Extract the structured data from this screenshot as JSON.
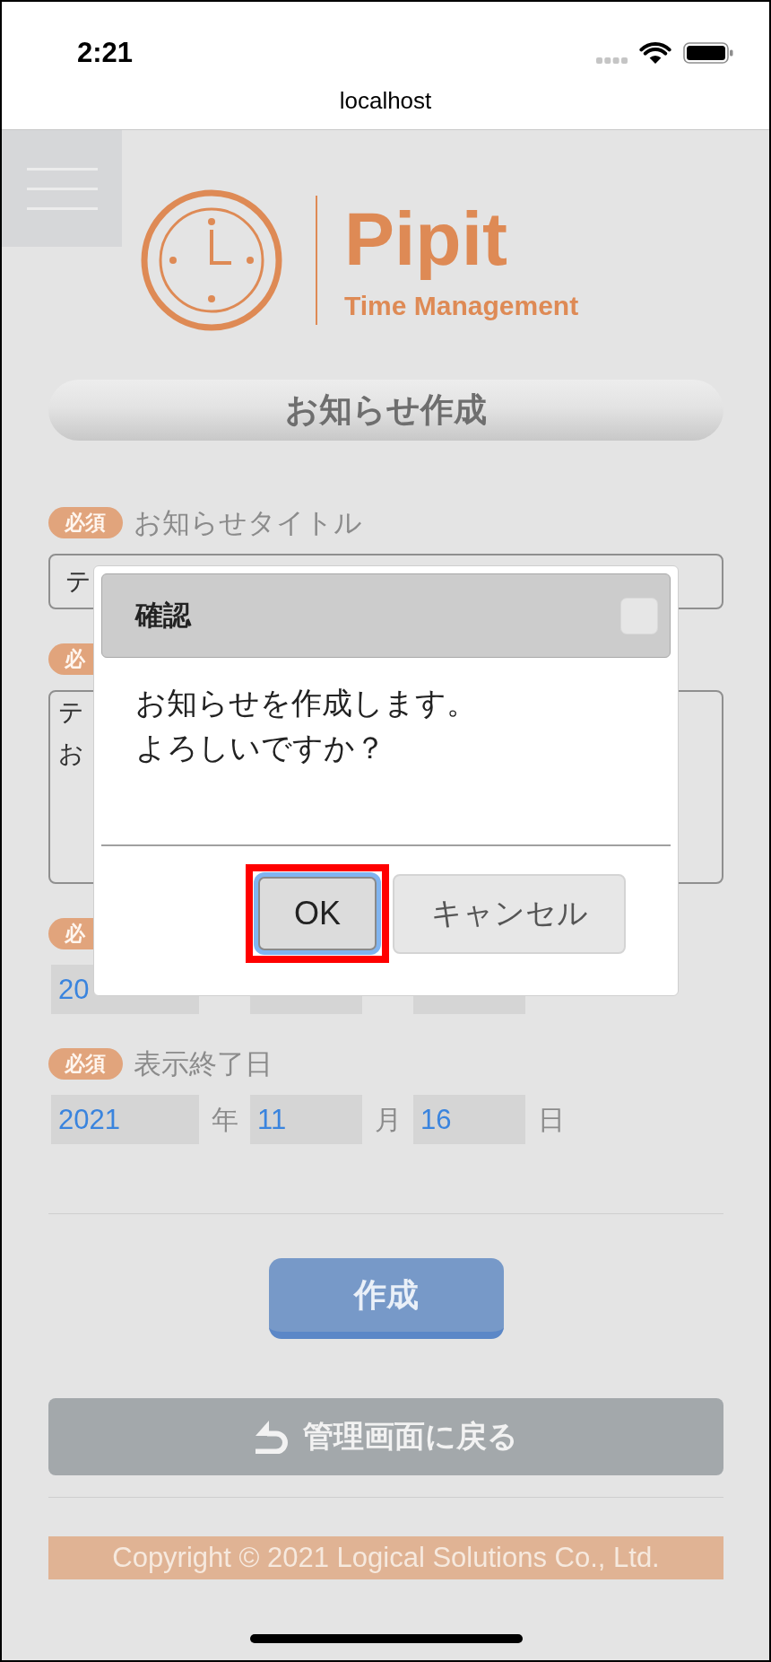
{
  "status_bar": {
    "time": "2:21"
  },
  "browser": {
    "url": "localhost"
  },
  "header": {
    "logo": {
      "name": "Pipit",
      "tagline": "Time Management"
    }
  },
  "page_title": "お知らせ作成",
  "form": {
    "fields": [
      {
        "kind": "text",
        "badge": "必須",
        "label": "お知らせタイトル",
        "value": "テ"
      },
      {
        "kind": "textarea",
        "badge": "必",
        "lines": [
          "テ",
          "お"
        ]
      },
      {
        "kind": "date",
        "badge": "必",
        "year": "20"
      },
      {
        "kind": "date",
        "badge": "必須",
        "label": "表示終了日",
        "year": "2021",
        "year_unit": "年",
        "month": "11",
        "month_unit": "月",
        "day": "16",
        "day_unit": "日"
      }
    ]
  },
  "submit_button": "作成",
  "back_button": "管理画面に戻る",
  "footer": {
    "copyright": "Copyright © 2021 Logical Solutions Co., Ltd."
  },
  "dialog": {
    "title": "確認",
    "message_lines": [
      "お知らせを作成します。",
      "よろしいですか？"
    ],
    "buttons": [
      {
        "label": "OK",
        "kind": "primary",
        "focused": true,
        "highlighted": true
      },
      {
        "label": "キャンセル",
        "kind": "secondary",
        "focused": false,
        "highlighted": false
      }
    ]
  }
}
